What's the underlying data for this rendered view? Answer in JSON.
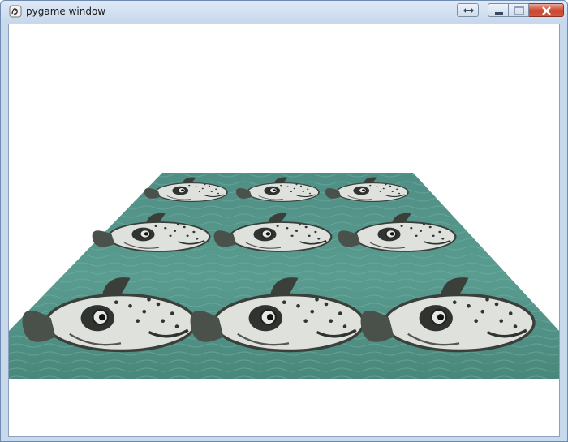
{
  "window": {
    "title": "pygame window",
    "app_icon": "pygame-snake-icon",
    "buttons": [
      "resize-icon",
      "minimize-icon",
      "maximize-icon",
      "close-icon"
    ],
    "accent": "#c9452e"
  },
  "scene": {
    "background_color": "#ffffff",
    "floor_color": "#4e8e82",
    "water_highlight": "#6fb0a4",
    "fish_body_color": "#d9dcd6",
    "fish_dark_color": "#2f3430",
    "rows": 3,
    "columns": 3,
    "texture": "pufferfish-tile"
  }
}
